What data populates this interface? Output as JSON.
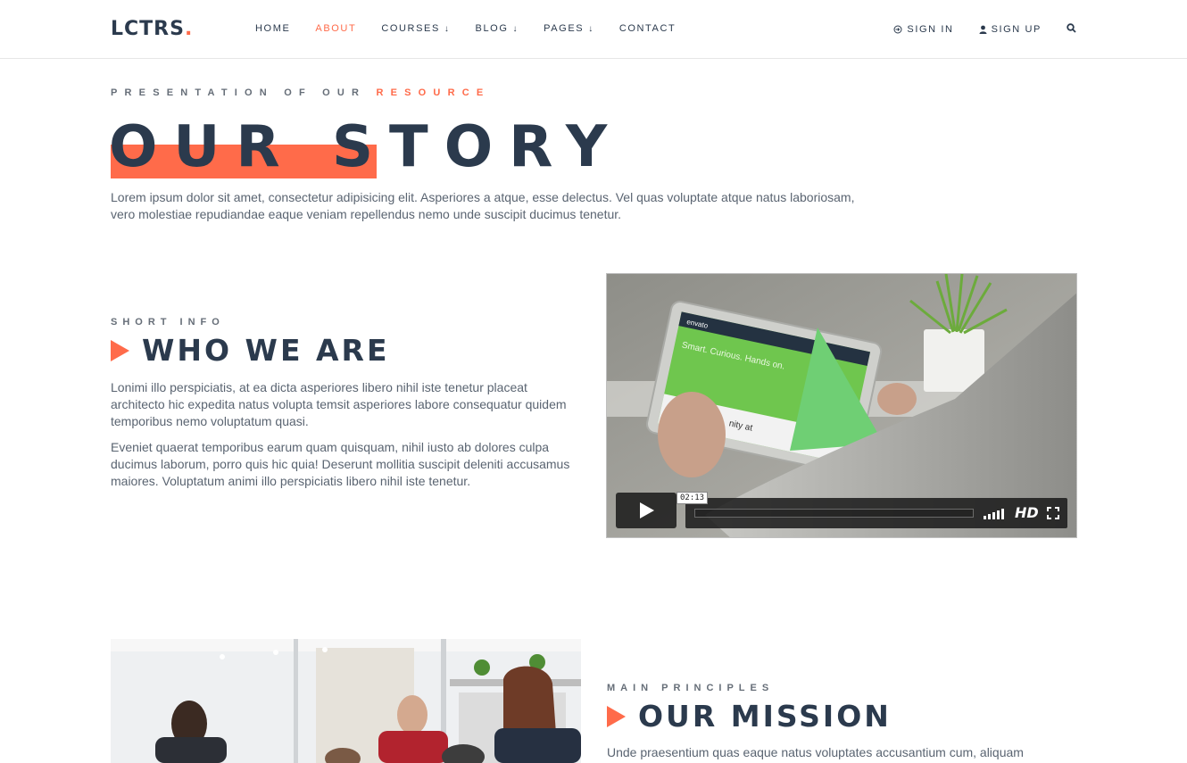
{
  "brand": {
    "name": "LCTRS",
    "dot": "."
  },
  "nav": {
    "items": [
      {
        "label": "HOME",
        "active": false,
        "dropdown": false
      },
      {
        "label": "ABOUT",
        "active": true,
        "dropdown": false
      },
      {
        "label": "COURSES",
        "active": false,
        "dropdown": true
      },
      {
        "label": "BLOG",
        "active": false,
        "dropdown": true
      },
      {
        "label": "PAGES",
        "active": false,
        "dropdown": true
      },
      {
        "label": "CONTACT",
        "active": false,
        "dropdown": false
      }
    ],
    "sign_in": "SIGN IN",
    "sign_up": "SIGN UP",
    "search_icon": "search-icon"
  },
  "hero": {
    "eyebrow_prefix": "PRESENTATION OF OUR",
    "eyebrow_accent": "RESOURCE",
    "title": "OUR STORY",
    "text": "Lorem ipsum dolor sit amet, consectetur adipisicing elit. Asperiores a atque, esse delectus. Vel quas voluptate atque natus laboriosam, vero molestiae repudiandae eaque veniam repellendus nemo unde suscipit ducimus tenetur."
  },
  "who": {
    "eyebrow": "SHORT INFO",
    "heading": "WHO WE ARE",
    "p1": "Lonimi illo perspiciatis, at ea dicta asperiores libero nihil iste tenetur placeat architecto hic expedita natus volupta temsit asperiores labore consequatur quidem temporibus nemo voluptatum quasi.",
    "p2": "Eveniet quaerat temporibus earum quam quisquam, nihil iusto ab dolores culpa ducimus laborum, porro quis hic quia! Deserunt mollitia suscipit deleniti accusamus maiores. Voluptatum animi illo perspiciatis libero nihil iste tenetur."
  },
  "video": {
    "timecode": "02:13",
    "hd_label": "HD",
    "screen_brand": "envato",
    "screen_headline": "Smart. Curious. Hands on.",
    "screen_snippet": "nity at",
    "progress_fraction": 0
  },
  "mission": {
    "eyebrow": "MAIN PRINCIPLES",
    "heading": "OUR MISSION",
    "text": "Unde praesentium quas eaque natus voluptates accusantium cum, aliquam"
  },
  "colors": {
    "accent": "#ff6b4a",
    "navy": "#2b3a4d",
    "body_text": "#5a6471"
  }
}
